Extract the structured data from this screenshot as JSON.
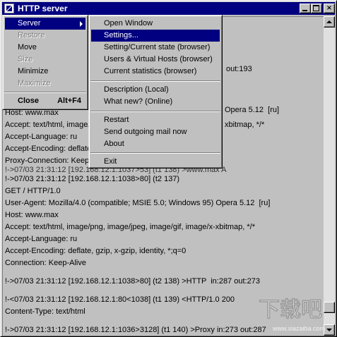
{
  "window": {
    "title": "HTTP server",
    "controls": {
      "minimize": "_",
      "maximize": "□",
      "close": "×"
    }
  },
  "system_menu": {
    "items": [
      {
        "label": "Server",
        "state": "selected",
        "has_submenu": true
      },
      {
        "label": "Restore",
        "state": "disabled"
      },
      {
        "label": "Move",
        "state": "enabled"
      },
      {
        "label": "Size",
        "state": "disabled"
      },
      {
        "label": "Minimize",
        "state": "enabled"
      },
      {
        "label": "Maximize",
        "state": "disabled"
      },
      {
        "label": "Close",
        "state": "enabled",
        "accelerator": "Alt+F4",
        "bold": true
      }
    ]
  },
  "server_submenu": {
    "items": [
      {
        "label": "Open Window"
      },
      {
        "label": "Settings...",
        "state": "selected"
      },
      {
        "label": "Setting/Current state (browser)"
      },
      {
        "label": "Users & Virtual Hosts (browser)"
      },
      {
        "label": "Current statistics (browser)"
      },
      {
        "label": "Description (Local)"
      },
      {
        "label": "What new?  (Online)"
      },
      {
        "label": "Restart"
      },
      {
        "label": "Send outgoing mail now"
      },
      {
        "label": "About"
      },
      {
        "label": "Exit"
      }
    ]
  },
  "log": {
    "visible_fragments": [
      "out:193",
      "Opera 5.12  [ru]",
      "xbitmap, */*",
      "!->07/03 21:31:12 [192.168.12.1:1037>53] (t1 138) >www.max A"
    ],
    "lines": [
      "Host: www.max",
      "Accept: text/html, image/",
      "Accept-Language: ru",
      "Accept-Encoding: deflate",
      "Proxy-Connection: Keep-",
      "!->07/03 21:31:12 [192.168.12.1:1038>80] (t2 137)",
      "GET / HTTP/1.0",
      "User-Agent: Mozilla/4.0 (compatible; MSIE 5.0; Windows 95) Opera 5.12  [ru]",
      "Host: www.max",
      "Accept: text/html, image/png, image/jpeg, image/gif, image/x-xbitmap, */*",
      "Accept-Language: ru",
      "Accept-Encoding: deflate, gzip, x-gzip, identity, *;q=0",
      "Connection: Keep-Alive",
      "!->07/03 21:31:12 [192.168.12.1:1038>80] (t2 138) >HTTP  in:287 out:273",
      "!-<07/03 21:31:12 [192.168.12.1:80<1038] (t1 139) <HTTP/1.0 200",
      "Content-Type: text/html",
      "!->07/03 21:31:12 [192.168.12.1:1036>3128] (t1 140) >Proxy in:273 out:287"
    ]
  },
  "watermark": {
    "text": "下载吧",
    "url": "www.xiazaiba.com"
  },
  "colors": {
    "face": "#c0c0c0",
    "titlebar": "#000080",
    "selection": "#000080",
    "disabled_text": "#808080"
  }
}
